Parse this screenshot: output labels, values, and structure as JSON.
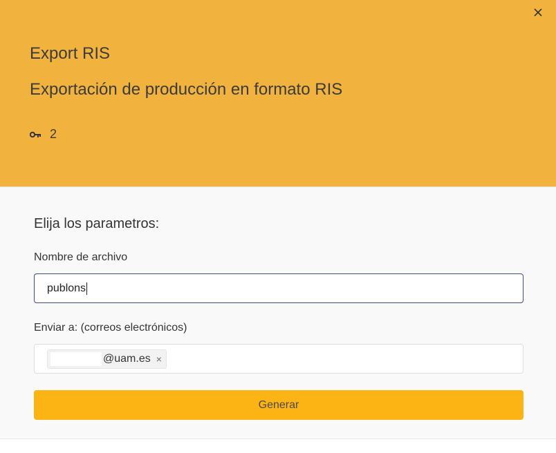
{
  "dialog": {
    "title": "Export RIS",
    "subtitle": "Exportación de producción en formato RIS",
    "key_count": "2",
    "header_color": "#f1b33d",
    "close_icon": "close-icon",
    "key_icon": "key-icon"
  },
  "form": {
    "heading": "Elija los parametros:",
    "filename_label": "Nombre de archivo",
    "filename_value": "publons",
    "email_label": "Enviar a: (correos electrónicos)",
    "email_tags": [
      {
        "visible_text": "@uam.es",
        "remove": "×"
      }
    ],
    "submit_label": "Generar",
    "submit_color": "#fcb414"
  }
}
